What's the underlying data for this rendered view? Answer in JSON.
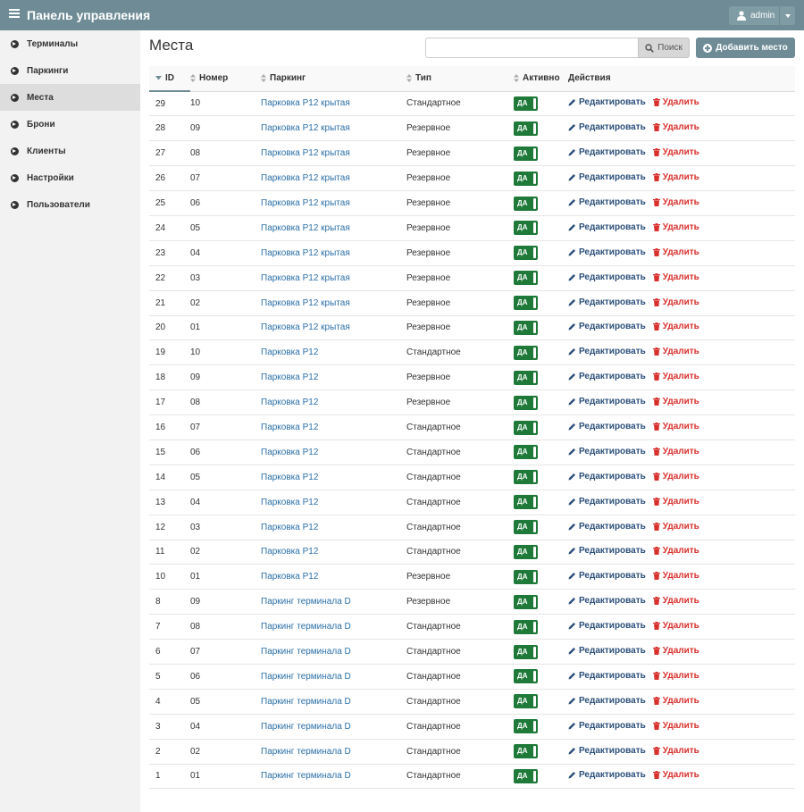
{
  "header": {
    "title": "Панель управления",
    "user": "admin"
  },
  "sidebar": {
    "items": [
      {
        "label": "Терминалы"
      },
      {
        "label": "Паркинги"
      },
      {
        "label": "Места"
      },
      {
        "label": "Брони"
      },
      {
        "label": "Клиенты"
      },
      {
        "label": "Настройки"
      },
      {
        "label": "Пользователи"
      }
    ],
    "active_index": 2
  },
  "main": {
    "title": "Места",
    "search": {
      "value": "",
      "placeholder": "",
      "button_label": "Поиск"
    },
    "add_button_label": "Добавить место",
    "table": {
      "columns": [
        "ID",
        "Номер",
        "Паркинг",
        "Тип",
        "Активно",
        "Действия"
      ],
      "sorted_column": "ID",
      "active_label": "ДА",
      "edit_label": "Редактировать",
      "delete_label": "Удалить",
      "rows": [
        {
          "id": "29",
          "number": "10",
          "parking": "Парковка Р12 крытая",
          "type": "Стандартное"
        },
        {
          "id": "28",
          "number": "09",
          "parking": "Парковка Р12 крытая",
          "type": "Резервное"
        },
        {
          "id": "27",
          "number": "08",
          "parking": "Парковка Р12 крытая",
          "type": "Резервное"
        },
        {
          "id": "26",
          "number": "07",
          "parking": "Парковка Р12 крытая",
          "type": "Резервное"
        },
        {
          "id": "25",
          "number": "06",
          "parking": "Парковка Р12 крытая",
          "type": "Резервное"
        },
        {
          "id": "24",
          "number": "05",
          "parking": "Парковка Р12 крытая",
          "type": "Резервное"
        },
        {
          "id": "23",
          "number": "04",
          "parking": "Парковка Р12 крытая",
          "type": "Резервное"
        },
        {
          "id": "22",
          "number": "03",
          "parking": "Парковка Р12 крытая",
          "type": "Резервное"
        },
        {
          "id": "21",
          "number": "02",
          "parking": "Парковка Р12 крытая",
          "type": "Резервное"
        },
        {
          "id": "20",
          "number": "01",
          "parking": "Парковка Р12 крытая",
          "type": "Резервное"
        },
        {
          "id": "19",
          "number": "10",
          "parking": "Парковка Р12",
          "type": "Стандартное"
        },
        {
          "id": "18",
          "number": "09",
          "parking": "Парковка Р12",
          "type": "Резервное"
        },
        {
          "id": "17",
          "number": "08",
          "parking": "Парковка Р12",
          "type": "Резервное"
        },
        {
          "id": "16",
          "number": "07",
          "parking": "Парковка Р12",
          "type": "Стандартное"
        },
        {
          "id": "15",
          "number": "06",
          "parking": "Парковка Р12",
          "type": "Стандартное"
        },
        {
          "id": "14",
          "number": "05",
          "parking": "Парковка Р12",
          "type": "Стандартное"
        },
        {
          "id": "13",
          "number": "04",
          "parking": "Парковка Р12",
          "type": "Стандартное"
        },
        {
          "id": "12",
          "number": "03",
          "parking": "Парковка Р12",
          "type": "Стандартное"
        },
        {
          "id": "11",
          "number": "02",
          "parking": "Парковка Р12",
          "type": "Стандартное"
        },
        {
          "id": "10",
          "number": "01",
          "parking": "Парковка Р12",
          "type": "Резервное"
        },
        {
          "id": "8",
          "number": "09",
          "parking": "Паркинг терминала D",
          "type": "Резервное"
        },
        {
          "id": "7",
          "number": "08",
          "parking": "Паркинг терминала D",
          "type": "Стандартное"
        },
        {
          "id": "6",
          "number": "07",
          "parking": "Паркинг терминала D",
          "type": "Стандартное"
        },
        {
          "id": "5",
          "number": "06",
          "parking": "Паркинг терминала D",
          "type": "Стандартное"
        },
        {
          "id": "4",
          "number": "05",
          "parking": "Паркинг терминала D",
          "type": "Стандартное"
        },
        {
          "id": "3",
          "number": "04",
          "parking": "Паркинг терминала D",
          "type": "Стандартное"
        },
        {
          "id": "2",
          "number": "02",
          "parking": "Паркинг терминала D",
          "type": "Стандартное"
        },
        {
          "id": "1",
          "number": "01",
          "parking": "Паркинг терминала D",
          "type": "Стандартное"
        }
      ]
    }
  },
  "colors": {
    "header_bg": "#6f8c96",
    "toggle_on": "#1f7a3a",
    "link": "#2b6fa8",
    "delete": "#d9302c"
  },
  "icons": {
    "menu": "hamburger-icon",
    "user": "user-icon",
    "sidebar_item": "circle-chevron-right-icon",
    "search": "search-icon",
    "add": "plus-circle-icon",
    "edit": "pencil-icon",
    "delete": "trash-icon",
    "sort": "sort-icon"
  }
}
